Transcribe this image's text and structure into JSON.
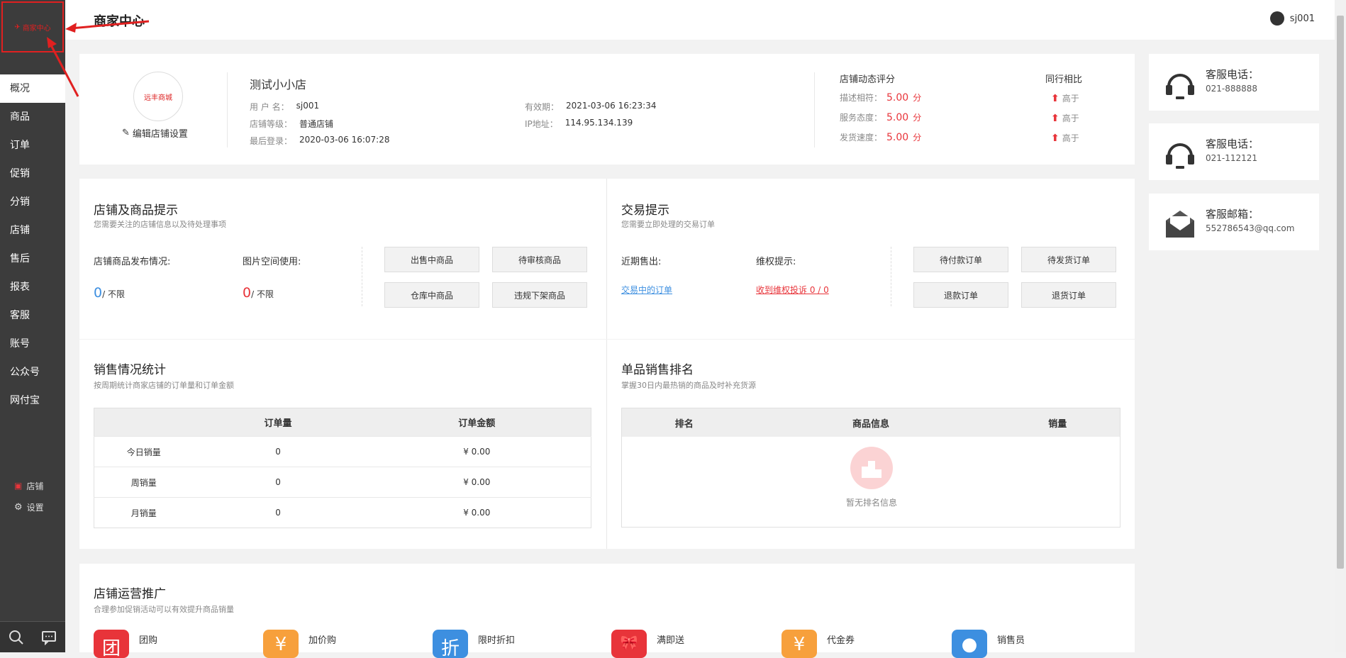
{
  "header": {
    "title": "商家中心",
    "username": "sj001"
  },
  "sidebar": {
    "logo_text": "商家中心",
    "items": [
      {
        "label": "概况",
        "active": true
      },
      {
        "label": "商品"
      },
      {
        "label": "订单"
      },
      {
        "label": "促销"
      },
      {
        "label": "分销"
      },
      {
        "label": "店铺"
      },
      {
        "label": "售后"
      },
      {
        "label": "报表"
      },
      {
        "label": "客服"
      },
      {
        "label": "账号"
      },
      {
        "label": "公众号"
      },
      {
        "label": "网付宝"
      }
    ],
    "links": [
      {
        "label": "店铺"
      },
      {
        "label": "设置"
      }
    ]
  },
  "shop": {
    "logo_text": "远丰商城",
    "edit_label": "编辑店铺设置",
    "name": "测试小小店",
    "username_label": "用 户 名：",
    "username": "sj001",
    "level_label": "店铺等级：",
    "level": "普通店铺",
    "last_login_label": "最后登录：",
    "last_login": "2020-03-06 16:07:28",
    "valid_label": "有效期：",
    "valid": "2021-03-06 16:23:34",
    "ip_label": "IP地址：",
    "ip": "114.95.134.139",
    "score_title": "店铺动态评分",
    "peer_title": "同行相比",
    "scores": [
      {
        "label": "描述相符：",
        "value": "5.00",
        "unit": "分",
        "peer": "高于"
      },
      {
        "label": "服务态度：",
        "value": "5.00",
        "unit": "分",
        "peer": "高于"
      },
      {
        "label": "发货速度：",
        "value": "5.00",
        "unit": "分",
        "peer": "高于"
      }
    ]
  },
  "contacts": [
    {
      "label": "客服电话：",
      "value": "021-888888",
      "icon": "headset-icon"
    },
    {
      "label": "客服电话：",
      "value": "021-112121",
      "icon": "headset-icon"
    },
    {
      "label": "客服邮箱：",
      "value": "552786543@qq.com",
      "icon": "envelope-icon"
    }
  ],
  "shop_tips": {
    "title": "店铺及商品提示",
    "subtitle": "您需要关注的店铺信息以及待处理事项",
    "publish_label": "店铺商品发布情况:",
    "publish_count": "0",
    "publish_limit": "/ 不限",
    "space_label": "图片空间使用:",
    "space_count": "0",
    "space_limit": "/ 不限",
    "buttons": [
      "出售中商品",
      "待审核商品",
      "仓库中商品",
      "违规下架商品"
    ]
  },
  "trade_tips": {
    "title": "交易提示",
    "subtitle": "您需要立即处理的交易订单",
    "recent_label": "近期售出:",
    "rights_label": "维权提示:",
    "trading_link": "交易中的订单",
    "complaint_link": "收到维权投诉 0 / 0",
    "buttons": [
      "待付款订单",
      "待发货订单",
      "退款订单",
      "退货订单"
    ]
  },
  "sales_stats": {
    "title": "销售情况统计",
    "subtitle": "按周期统计商家店铺的订单量和订单金额",
    "headers": [
      "",
      "订单量",
      "订单金额"
    ],
    "rows": [
      {
        "label": "今日销量",
        "count": "0",
        "amount": "¥ 0.00"
      },
      {
        "label": "周销量",
        "count": "0",
        "amount": "¥ 0.00"
      },
      {
        "label": "月销量",
        "count": "0",
        "amount": "¥ 0.00"
      }
    ]
  },
  "ranking": {
    "title": "单品销售排名",
    "subtitle": "掌握30日内最热销的商品及时补充货源",
    "headers": [
      "排名",
      "商品信息",
      "销量"
    ],
    "empty_text": "暂无排名信息"
  },
  "promotion": {
    "title": "店铺运营推广",
    "subtitle": "合理参加促销活动可以有效提升商品销量",
    "items": [
      {
        "label": "团购",
        "glyph": "团",
        "color": "#e8343a"
      },
      {
        "label": "加价购",
        "glyph": "¥",
        "color": "#f7a03c"
      },
      {
        "label": "限时折扣",
        "glyph": "折",
        "color": "#3d8fe0"
      },
      {
        "label": "满即送",
        "glyph": "🎀",
        "color": "#e8343a"
      },
      {
        "label": "代金券",
        "glyph": "¥",
        "color": "#f7a03c"
      },
      {
        "label": "销售员",
        "glyph": "●",
        "color": "#3d8fe0"
      }
    ]
  }
}
